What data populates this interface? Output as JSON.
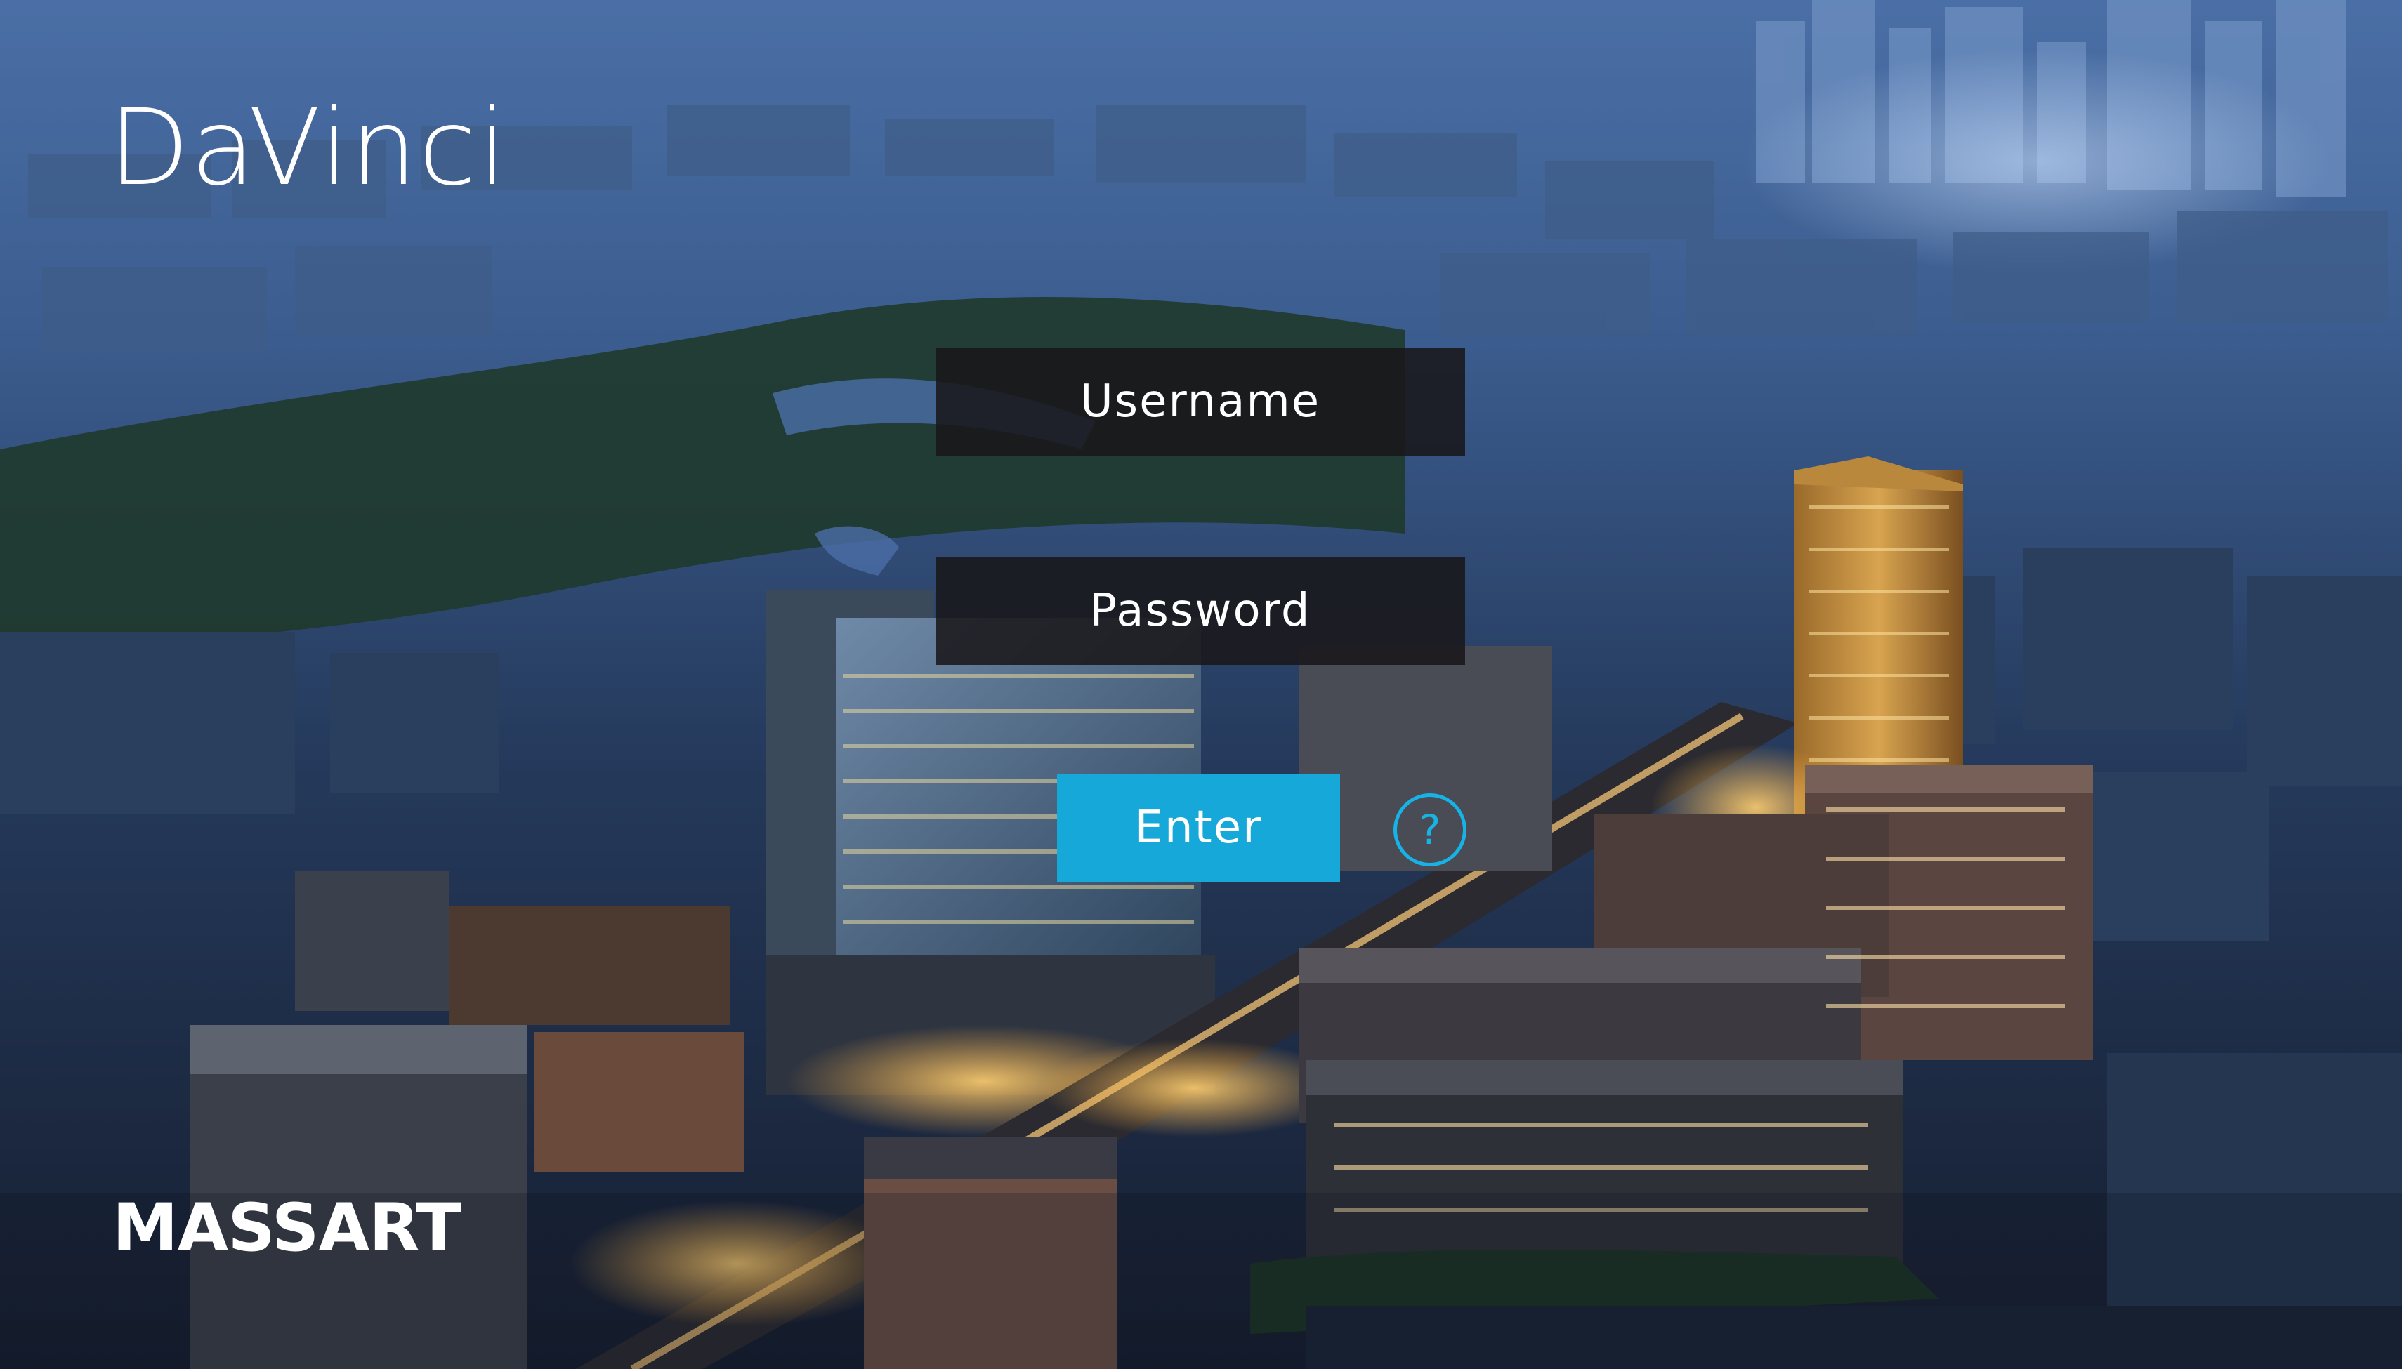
{
  "branding": {
    "app_logo_text": "DaVinci",
    "institution_logo_text": "MASSART"
  },
  "login_form": {
    "username_placeholder": "Username",
    "password_placeholder": "Password",
    "enter_label": "Enter",
    "help_label": "?"
  },
  "colors": {
    "accent": "#16a8d8",
    "field_background": "#181618",
    "text": "#ffffff",
    "help_ring": "#17b3e6"
  },
  "icons": {
    "help": "question-circle-icon"
  }
}
